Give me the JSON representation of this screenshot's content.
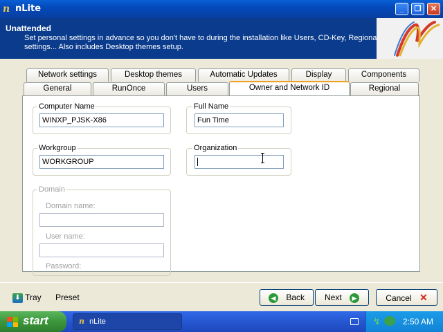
{
  "window": {
    "title": "nLite",
    "minimize_glyph": "_",
    "maximize_glyph": "❐",
    "close_glyph": "✕"
  },
  "header": {
    "title": "Unattended",
    "description": "Set personal settings in advance so you don't have to during the installation like Users, CD-Key, Regional settings... Also includes Desktop themes setup."
  },
  "tabs_row1": [
    "Network settings",
    "Desktop themes",
    "Automatic Updates",
    "Display",
    "Components"
  ],
  "tabs_row2": [
    "General",
    "RunOnce",
    "Users",
    "Owner and Network ID",
    "Regional"
  ],
  "active_tab": "Owner and Network ID",
  "form": {
    "computer_name": {
      "label": "Computer Name",
      "value": "WINXP_PJSK-X86"
    },
    "full_name": {
      "label": "Full Name",
      "value": "Fun Time"
    },
    "workgroup": {
      "label": "Workgroup",
      "value": "WORKGROUP"
    },
    "organization": {
      "label": "Organization",
      "value": ""
    },
    "domain": {
      "label": "Domain",
      "domain_name_label": "Domain name:",
      "user_name_label": "User name:",
      "password_label": "Password:"
    }
  },
  "footer": {
    "tray": "Tray",
    "preset": "Preset",
    "back": "Back",
    "next": "Next",
    "cancel": "Cancel"
  },
  "taskbar": {
    "start": "start",
    "task": "nLite",
    "clock": "2:50 AM"
  },
  "colors": {
    "header_bg": "#0a3b8c",
    "taskbar": "#245edb",
    "start": "#3c973c",
    "active_tab_accent": "#f0a020"
  }
}
